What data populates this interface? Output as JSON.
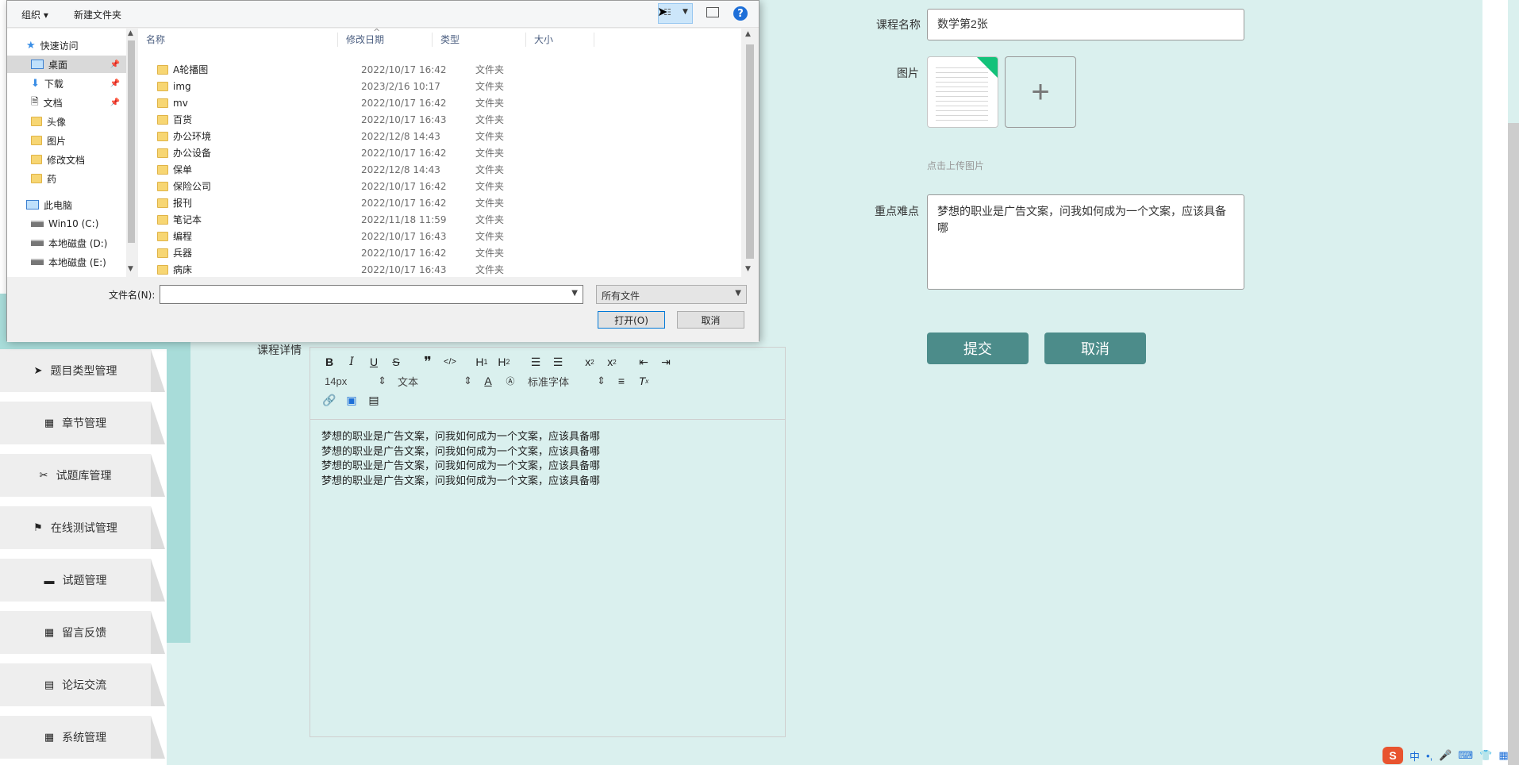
{
  "sidebar": {
    "items": [
      {
        "label": "题目类型管理",
        "icon": "send-icon",
        "glyph": "➤"
      },
      {
        "label": "章节管理",
        "icon": "grid-icon",
        "glyph": "▦"
      },
      {
        "label": "试题库管理",
        "icon": "ticket-icon",
        "glyph": "✂"
      },
      {
        "label": "在线测试管理",
        "icon": "flag-icon",
        "glyph": "⚑"
      },
      {
        "label": "试题管理",
        "icon": "monitor-icon",
        "glyph": "▬"
      },
      {
        "label": "留言反馈",
        "icon": "grid-icon",
        "glyph": "▦"
      },
      {
        "label": "论坛交流",
        "icon": "clipboard-icon",
        "glyph": "▤"
      },
      {
        "label": "系统管理",
        "icon": "grid-icon",
        "glyph": "▦"
      }
    ]
  },
  "form": {
    "course_name_label": "课程名称",
    "course_name_value": "数学第2张",
    "image_label": "图片",
    "upload_hint": "点击上传图片",
    "upload_plus": "+",
    "difficulty_label": "重点难点",
    "difficulty_value": "梦想的职业是广告文案，问我如何成为一个文案，应该具备哪",
    "submit_label": "提交",
    "cancel_label": "取消",
    "details_label": "课程详情"
  },
  "editor": {
    "font_size": "14px",
    "block_type": "文本",
    "font_family": "标准字体",
    "content_lines": [
      "梦想的职业是广告文案，问我如何成为一个文案，应该具备哪",
      "梦想的职业是广告文案，问我如何成为一个文案，应该具备哪",
      "梦想的职业是广告文案，问我如何成为一个文案，应该具备哪",
      "梦想的职业是广告文案，问我如何成为一个文案，应该具备哪"
    ]
  },
  "dialog": {
    "toolbar": {
      "organize": "组织 ▾",
      "new_folder": "新建文件夹",
      "help": "?"
    },
    "nav": [
      {
        "label": "快速访问",
        "kind": "star"
      },
      {
        "label": "桌面",
        "kind": "desktop",
        "pinned": true,
        "selected": true
      },
      {
        "label": "下载",
        "kind": "download",
        "pinned": true
      },
      {
        "label": "文档",
        "kind": "doc",
        "pinned": true
      },
      {
        "label": "头像",
        "kind": "folder"
      },
      {
        "label": "图片",
        "kind": "folder"
      },
      {
        "label": "修改文档",
        "kind": "folder"
      },
      {
        "label": "药",
        "kind": "folder"
      },
      {
        "label": "此电脑",
        "kind": "pc"
      },
      {
        "label": "Win10 (C:)",
        "kind": "drive"
      },
      {
        "label": "本地磁盘 (D:)",
        "kind": "drive"
      },
      {
        "label": "本地磁盘 (E:)",
        "kind": "drive"
      }
    ],
    "columns": [
      "名称",
      "修改日期",
      "类型",
      "大小"
    ],
    "files": [
      {
        "name": "A轮播图",
        "date": "2022/10/17 16:42",
        "type": "文件夹"
      },
      {
        "name": "img",
        "date": "2023/2/16 10:17",
        "type": "文件夹"
      },
      {
        "name": "mv",
        "date": "2022/10/17 16:42",
        "type": "文件夹"
      },
      {
        "name": "百货",
        "date": "2022/10/17 16:43",
        "type": "文件夹"
      },
      {
        "name": "办公环境",
        "date": "2022/12/8 14:43",
        "type": "文件夹"
      },
      {
        "name": "办公设备",
        "date": "2022/10/17 16:42",
        "type": "文件夹"
      },
      {
        "name": "保单",
        "date": "2022/12/8 14:43",
        "type": "文件夹"
      },
      {
        "name": "保险公司",
        "date": "2022/10/17 16:42",
        "type": "文件夹"
      },
      {
        "name": "报刊",
        "date": "2022/10/17 16:42",
        "type": "文件夹"
      },
      {
        "name": "笔记本",
        "date": "2022/11/18 11:59",
        "type": "文件夹"
      },
      {
        "name": "编程",
        "date": "2022/10/17 16:43",
        "type": "文件夹"
      },
      {
        "name": "兵器",
        "date": "2022/10/17 16:42",
        "type": "文件夹"
      },
      {
        "name": "病床",
        "date": "2022/10/17 16:43",
        "type": "文件夹"
      }
    ],
    "filename_label": "文件名(N):",
    "filename_value": "",
    "filter": "所有文件",
    "open_label": "打开(O)",
    "cancel_label": "取消"
  },
  "tray": {
    "ime": "中",
    "punct": "•,",
    "logo": "S"
  }
}
